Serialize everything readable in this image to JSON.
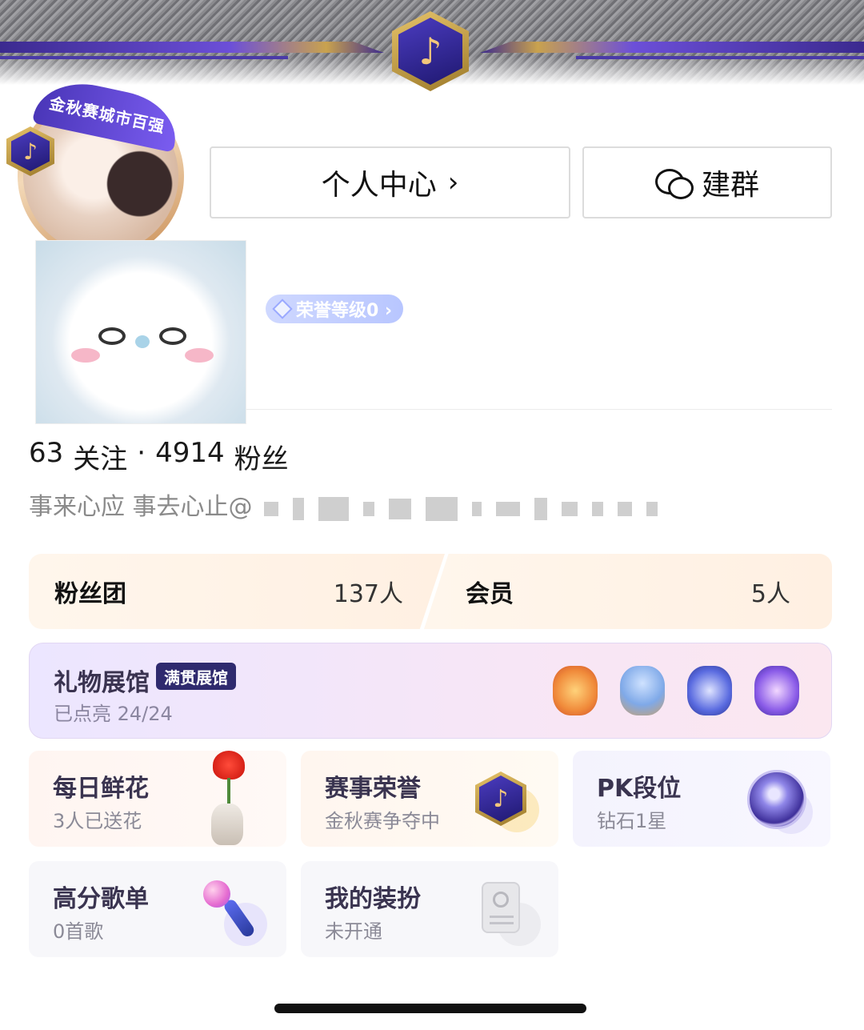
{
  "header": {
    "avatar_banner_text": "金秋赛城市百强",
    "center_button_label": "个人中心",
    "center_button_chevron": "›",
    "group_button_label": "建群"
  },
  "profile": {
    "honor_label": "荣誉等级0 ›",
    "stats": {
      "following_count": "63",
      "following_label": "关注",
      "separator": "·",
      "fans_count": "4914",
      "fans_label": "粉丝"
    },
    "bio": "事来心应 事去心止@"
  },
  "fan_club": {
    "left": {
      "title": "粉丝团",
      "count": "137人"
    },
    "right": {
      "title": "会员",
      "count": "5人"
    }
  },
  "gift_hall": {
    "title": "礼物展馆",
    "tag": "满贯展馆",
    "subtitle": "已点亮 24/24",
    "items": [
      {
        "icon": "carnival-gift-icon",
        "color": "#f08a3a"
      },
      {
        "icon": "jellyfish-gift-icon",
        "color": "#7fa9e8"
      },
      {
        "icon": "dragon-gift-icon",
        "color": "#5a6be0"
      },
      {
        "icon": "rocket-gift-icon",
        "color": "#8a5be8"
      }
    ]
  },
  "tiles": [
    {
      "title": "每日鲜花",
      "subtitle": "3人已送花",
      "icon": "rose-vase-icon"
    },
    {
      "title": "赛事荣誉",
      "subtitle": "金秋赛争夺中",
      "icon": "music-hexagon-icon"
    },
    {
      "title": "PK段位",
      "subtitle": "钻石1星",
      "icon": "diamond-rank-icon"
    },
    {
      "title": "高分歌单",
      "subtitle": "0首歌",
      "icon": "microphone-icon"
    },
    {
      "title": "我的装扮",
      "subtitle": "未开通",
      "icon": "id-card-icon"
    }
  ],
  "colors": {
    "brand_purple": "#4a36b8",
    "gold": "#e6c36a",
    "fan_bg": "#fff6ec",
    "gift_bg": "#ece6ff"
  }
}
